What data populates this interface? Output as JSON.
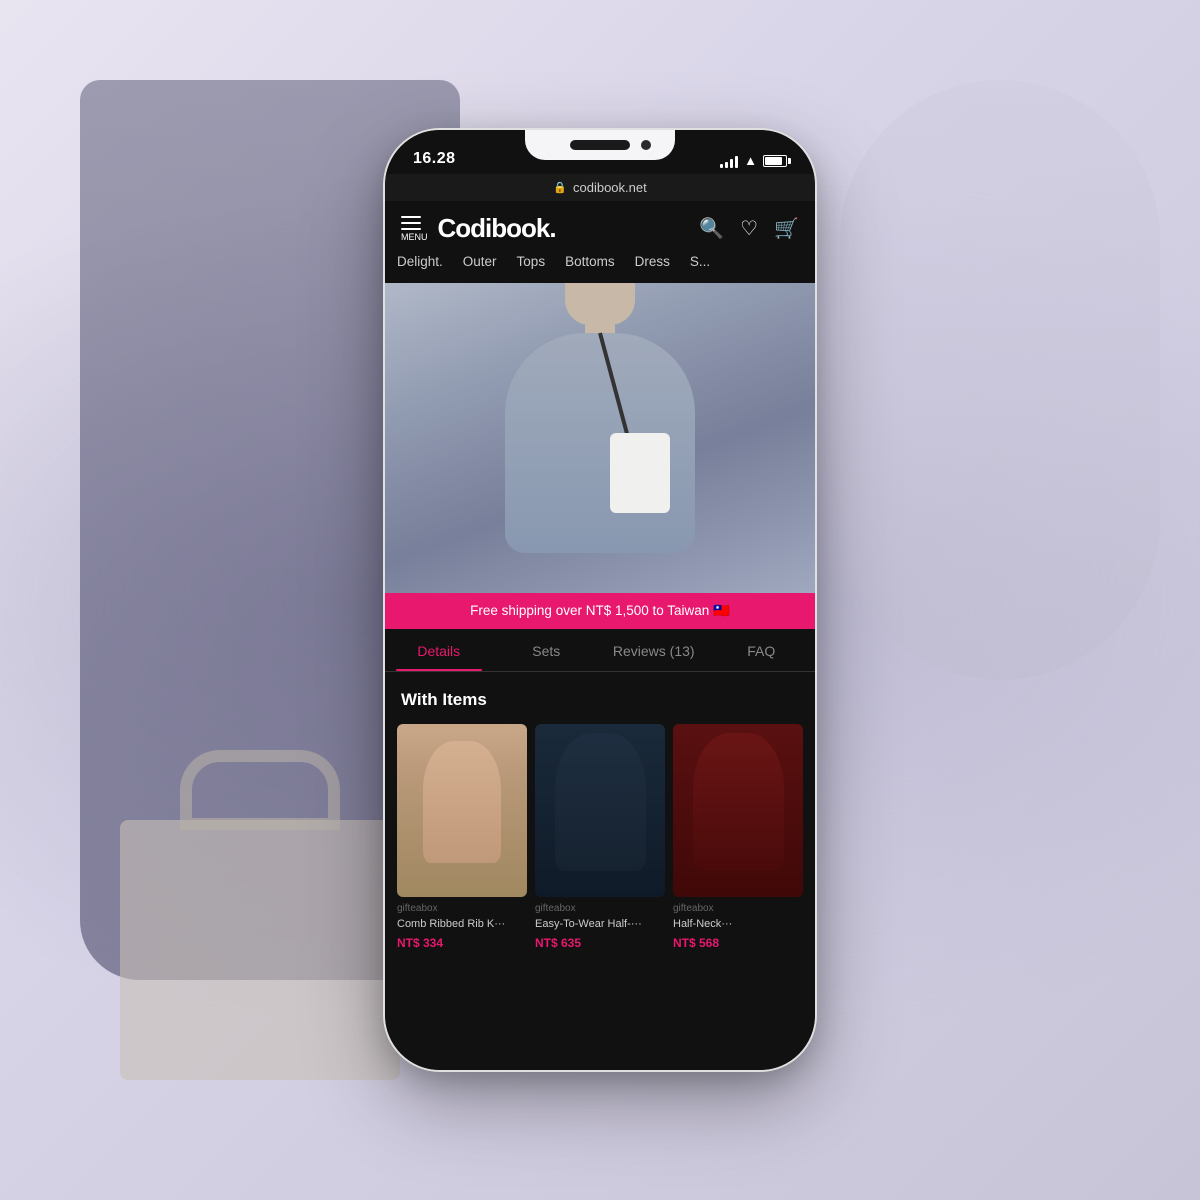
{
  "background": {
    "color": "#e8e4f0"
  },
  "phone": {
    "status_bar": {
      "time": "16.28",
      "signal": "4 bars",
      "wifi": "on",
      "battery": "full"
    },
    "url_bar": {
      "lock_icon": "🔒",
      "url": "codibook.net"
    },
    "header": {
      "menu_label": "MENU",
      "brand": "Codibook.",
      "search_icon": "search",
      "heart_icon": "heart",
      "cart_icon": "cart"
    },
    "nav": {
      "items": [
        {
          "label": "Delight."
        },
        {
          "label": "Outer"
        },
        {
          "label": "Tops"
        },
        {
          "label": "Bottoms"
        },
        {
          "label": "Dress"
        },
        {
          "label": "S..."
        }
      ]
    },
    "shipping_banner": {
      "text": "Free shipping over NT$ 1,500 to Taiwan 🇹🇼"
    },
    "tabs": [
      {
        "label": "Details",
        "active": true
      },
      {
        "label": "Sets",
        "active": false
      },
      {
        "label": "Reviews (13)",
        "active": false
      },
      {
        "label": "FAQ",
        "active": false
      }
    ],
    "section": {
      "title": "With Items"
    },
    "products": [
      {
        "seller": "gifteabox",
        "name": "Comb Ribbed Rib K···",
        "price": "NT$ 334",
        "image_type": "1"
      },
      {
        "seller": "gifteabox",
        "name": "Easy-To-Wear Half-···",
        "price": "NT$ 635",
        "image_type": "2"
      },
      {
        "seller": "gifteabox",
        "name": "Half-Neck···",
        "price": "NT$ 568",
        "image_type": "3"
      }
    ]
  }
}
